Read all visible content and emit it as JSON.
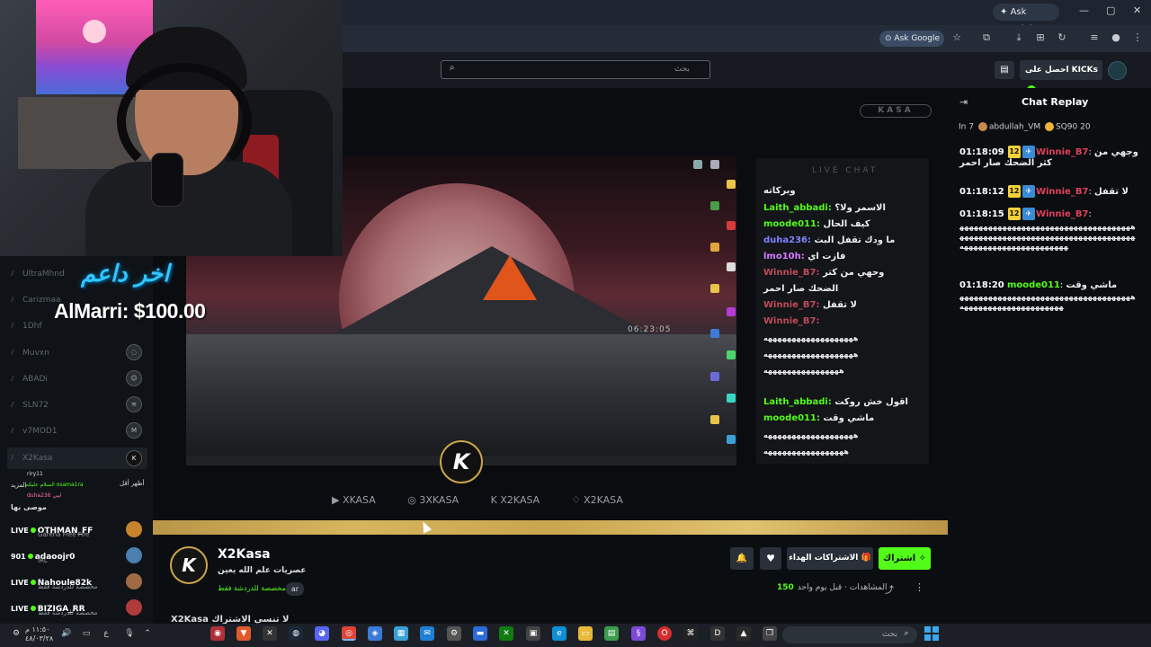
{
  "browser": {
    "ask_gemini": "Ask Gemini",
    "ask_google": "Ask Google",
    "win_min": "—",
    "win_max": "▢",
    "win_close": "✕"
  },
  "header": {
    "search_placeholder": "بحث",
    "get_kicks": "احصل على KICKs"
  },
  "overlay": {
    "arabic_text": "اخر داعم",
    "donation": "AlMarri: $100.00"
  },
  "sidebar": {
    "followed": [
      {
        "name": "UltraMhnd"
      },
      {
        "name": "Carizmaa"
      },
      {
        "name": "1Dhf"
      },
      {
        "name": "Muvxn"
      },
      {
        "name": "ABADi"
      },
      {
        "name": "SLN72"
      },
      {
        "name": "v7MOD1"
      },
      {
        "name": "X2Kasa"
      }
    ],
    "mini_chat": {
      "line1": "riry11",
      "line2": "السلام عليكم osama1ra",
      "line3": "duha236 ابيي",
      "show_more": "أظهر أقل",
      "more_label": "المزيد",
      "recommended": "موصى بها"
    },
    "live": [
      {
        "status": "LIVE",
        "name": "OTHMAN_FF",
        "sub": "Garena Free Fire"
      },
      {
        "status": "901",
        "name": "adaoojr0",
        "sub": "IRL"
      },
      {
        "status": "LIVE",
        "name": "Nahoule82k",
        "sub": "مخصصة للدردشة فقط"
      },
      {
        "status": "LIVE",
        "name": "BIZIGA_RR",
        "sub": "مخصصة للدردشة فقط"
      }
    ]
  },
  "video": {
    "kasa_logo": "KASA",
    "clock": "06:23:05",
    "inner_chat_title": "LIVE CHAT",
    "inner_chat": [
      {
        "user": "",
        "text": "وبركاته"
      },
      {
        "user": "Laith_abbadi:",
        "text": "الاسمر ولا؟"
      },
      {
        "user": "moode011:",
        "text": "كيف الحال"
      },
      {
        "user": "duha236:",
        "text": "ما ودك تقفل البث"
      },
      {
        "user": "lmo10h:",
        "text": "فازت اي"
      },
      {
        "user": "Winnie_B7:",
        "text": "وحهي من كتر"
      },
      {
        "user": "",
        "text": "الضحك صار احمر"
      },
      {
        "user": "Winnie_B7:",
        "text": "لا تقفل"
      },
      {
        "user": "Winnie_B7:",
        "text": ""
      },
      {
        "user": "",
        "text": "هههههههههههههههههههه"
      },
      {
        "user": "",
        "text": "هههههههههههههههههههه"
      },
      {
        "user": "",
        "text": "ههههههههههههههههه"
      },
      {
        "user": "Laith_abbadi:",
        "text": "اقول خش روكت"
      },
      {
        "user": "moode011:",
        "text": "ماشي وقت"
      },
      {
        "user": "",
        "text": "هههههههههههههههههههه"
      },
      {
        "user": "",
        "text": "هههههههههههههههههه"
      }
    ],
    "kick_badge": "K",
    "socials": [
      "XKASA",
      "3XKASA",
      "X2KASA",
      "X2KASA"
    ]
  },
  "channel": {
    "avatar_letter": "K",
    "name": "X2Kasa",
    "title": "عصريات علم الله يعين",
    "tag": "مخصصة للدردشة فقط",
    "lang": "ar",
    "subscribe": "اشتراك",
    "gift_subs": "الاشتراكات الهداء",
    "views_count": "150",
    "views_label": "المشاهدات",
    "time_ago": "قبل يوم واحد",
    "cut_title": "X2Kasa لا تنسى الاشتراك"
  },
  "chat": {
    "title": "Chat Replay",
    "gifters": [
      {
        "label": "In 7",
        "color": ""
      },
      {
        "label": "abdullah_VM",
        "color": "#c78a4a"
      },
      {
        "label": "SQ90 20",
        "color": "#f2b33b"
      }
    ],
    "messages": [
      {
        "time": "01:18:09",
        "badge": "12",
        "user": "Winnie_B7",
        "text": "وجهي من كثر الضحك صار احمر",
        "wrap": ""
      },
      {
        "time": "01:18:12",
        "badge": "12",
        "user": "Winnie_B7",
        "text": "لا تقفل",
        "wrap": ""
      },
      {
        "time": "01:18:15",
        "badge": "12",
        "user": "Winnie_B7",
        "text": "",
        "wrap": "ههههههههههههههههههههههههههههههههههههههههههههههههههههههههههههههههههههههههههههههههههههههههههههههههه"
      },
      {
        "time": "01:18:20",
        "badge": "",
        "user": "moode011",
        "text": "ماشي وقت",
        "wrap": "ههههههههههههههههههههههههههههههههههههههههههههههههههههههههههه"
      }
    ]
  },
  "taskbar": {
    "search": "بحث",
    "clock_time": "١١:٥٠ م",
    "clock_date": "٤٨/٠٣/٢٨"
  }
}
